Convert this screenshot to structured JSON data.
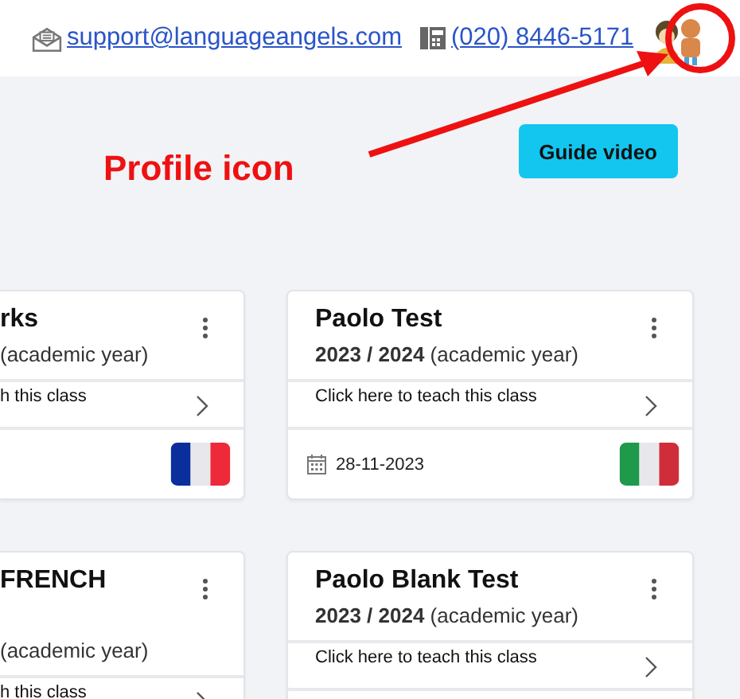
{
  "header": {
    "email": "support@languageangels.com",
    "phone": "(020) 8446-5171"
  },
  "annotation": {
    "label": "Profile icon"
  },
  "guide_button": "Guide video",
  "class_cards": [
    {
      "cut": true,
      "title": "rks",
      "year": "(academic year)",
      "link": "h this class",
      "flag": {
        "kind": "france"
      }
    },
    {
      "cut": false,
      "title": "Paolo Test",
      "year": "**2023 / 2024** (academic year)",
      "link": "Click here to teach this class",
      "date": "28-11-2023",
      "flag": {
        "kind": "italy"
      }
    },
    {
      "cut": true,
      "title": "FRENCH",
      "year": "(academic year)",
      "link": "h this class",
      "tall": true
    },
    {
      "cut": false,
      "title": "Paolo Blank Test",
      "year": "**2023 / 2024** (academic year)",
      "link": "Click here to teach this class"
    }
  ]
}
